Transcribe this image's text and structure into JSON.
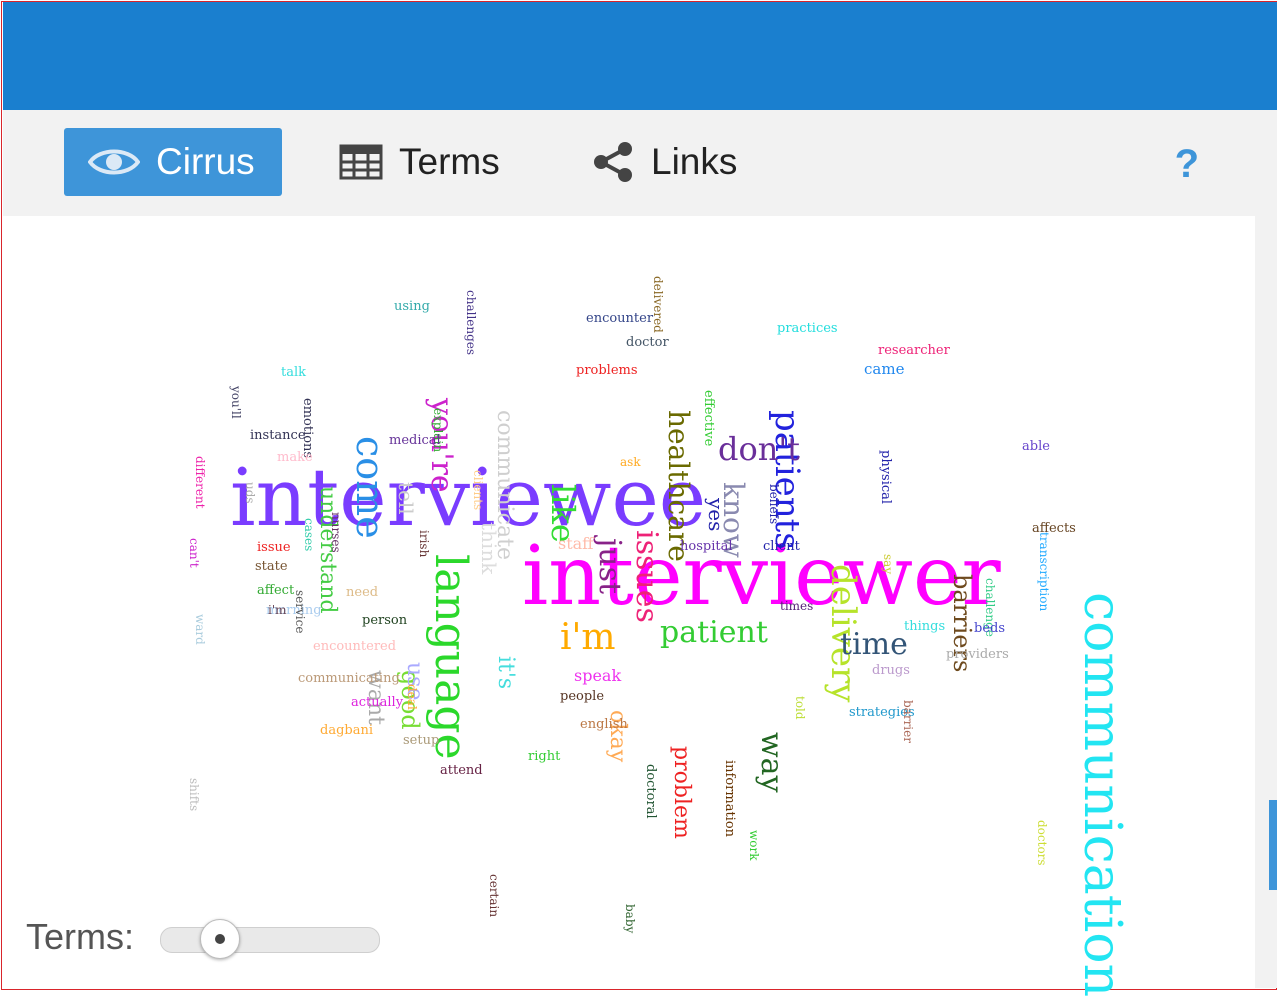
{
  "tabs": {
    "cirrus": "Cirrus",
    "terms": "Terms",
    "links": "Links",
    "help": "?"
  },
  "colors": {
    "topbar": "#1a7fcf",
    "active_tab": "#3e95d9",
    "border": "#d9252b"
  },
  "slider": {
    "label": "Terms:",
    "value_fraction": 0.22
  },
  "cloud": {
    "words": [
      {
        "text": "interviewee",
        "color": "#7a3cff"
      },
      {
        "text": "interviewer",
        "color": "#ff00ff"
      },
      {
        "text": "communication",
        "color": "#22e5f2"
      },
      {
        "text": "language",
        "color": "#2bd82b"
      },
      {
        "text": "patients",
        "color": "#2222dd"
      },
      {
        "text": "delivery",
        "color": "#b6e32a"
      },
      {
        "text": "come",
        "color": "#2a8fe6"
      },
      {
        "text": "you're",
        "color": "#cc22cc"
      },
      {
        "text": "healthcare",
        "color": "#6a6a00"
      },
      {
        "text": "like",
        "color": "#33dd33"
      },
      {
        "text": "just",
        "color": "#882288"
      },
      {
        "text": "issues",
        "color": "#ee2277"
      },
      {
        "text": "know",
        "color": "#8a8ab0"
      },
      {
        "text": "don't",
        "color": "#6a2f9a"
      },
      {
        "text": "communicate",
        "color": "#cfcfcf"
      },
      {
        "text": "barriers",
        "color": "#6e4a1e"
      },
      {
        "text": "time",
        "color": "#335577"
      },
      {
        "text": "i'm",
        "color": "#ffaa00"
      },
      {
        "text": "patient",
        "color": "#33cc33"
      },
      {
        "text": "way",
        "color": "#226622"
      },
      {
        "text": "understand",
        "color": "#44cc44"
      },
      {
        "text": "good",
        "color": "#77dd33"
      },
      {
        "text": "want",
        "color": "#aaaaaa"
      },
      {
        "text": "it's",
        "color": "#44dddd"
      },
      {
        "text": "okay",
        "color": "#ffaa55"
      },
      {
        "text": "problem",
        "color": "#ee2222"
      },
      {
        "text": "use",
        "color": "#aaaaff"
      },
      {
        "text": "tell",
        "color": "#cccccc"
      },
      {
        "text": "think",
        "color": "#dddddd"
      },
      {
        "text": "yes",
        "color": "#2222aa"
      },
      {
        "text": "staff",
        "color": "#ffbbaa"
      },
      {
        "text": "speak",
        "color": "#ee33ee"
      },
      {
        "text": "doctoral",
        "color": "#225533"
      },
      {
        "text": "information",
        "color": "#663300"
      },
      {
        "text": "emotions",
        "color": "#333355"
      },
      {
        "text": "challenges",
        "color": "#443388"
      },
      {
        "text": "delivered",
        "color": "#886622"
      },
      {
        "text": "effective",
        "color": "#33cc33"
      },
      {
        "text": "practices",
        "color": "#22dddd"
      },
      {
        "text": "researcher",
        "color": "#ee2277"
      },
      {
        "text": "came",
        "color": "#2288ee"
      },
      {
        "text": "physical",
        "color": "#2222aa"
      },
      {
        "text": "beliefs",
        "color": "#2222aa"
      },
      {
        "text": "transcription",
        "color": "#22aaff"
      },
      {
        "text": "able",
        "color": "#6644cc"
      },
      {
        "text": "challenge",
        "color": "#33cc88"
      },
      {
        "text": "affects",
        "color": "#664422"
      },
      {
        "text": "say",
        "color": "#cccc33"
      },
      {
        "text": "using",
        "color": "#33aaaa"
      },
      {
        "text": "explain",
        "color": "#33aa33"
      },
      {
        "text": "clients",
        "color": "#ffcc88"
      },
      {
        "text": "encounter",
        "color": "#334488"
      },
      {
        "text": "doctor",
        "color": "#445566"
      },
      {
        "text": "problems",
        "color": "#ee2222"
      },
      {
        "text": "medical",
        "color": "#663399"
      },
      {
        "text": "you'll",
        "color": "#444466"
      },
      {
        "text": "talk",
        "color": "#33dddd"
      },
      {
        "text": "cases",
        "color": "#33ccaa"
      },
      {
        "text": "nurses",
        "color": "#663366"
      },
      {
        "text": "instance",
        "color": "#333355"
      },
      {
        "text": "different",
        "color": "#ee22aa"
      },
      {
        "text": "make",
        "color": "#ffbbcc"
      },
      {
        "text": "uds",
        "color": "#aaaaaa"
      },
      {
        "text": "irish",
        "color": "#663333"
      },
      {
        "text": "ask",
        "color": "#ffaa22"
      },
      {
        "text": "can't",
        "color": "#cc22cc"
      },
      {
        "text": "issue",
        "color": "#ee2222"
      },
      {
        "text": "state",
        "color": "#775533"
      },
      {
        "text": "affect",
        "color": "#33aa33"
      },
      {
        "text": "morning",
        "color": "#aaccee"
      },
      {
        "text": "need",
        "color": "#ddbb88"
      },
      {
        "text": "service",
        "color": "#555555"
      },
      {
        "text": "things",
        "color": "#33dddd"
      },
      {
        "text": "person",
        "color": "#224422"
      },
      {
        "text": "encountered",
        "color": "#ffbbbb"
      },
      {
        "text": "deal",
        "color": "#ffaa33"
      },
      {
        "text": "communicating",
        "color": "#bb9977"
      },
      {
        "text": "actually",
        "color": "#dd22dd"
      },
      {
        "text": "dagbani",
        "color": "#ffaa33"
      },
      {
        "text": "setup",
        "color": "#aa9977"
      },
      {
        "text": "attend",
        "color": "#662244"
      },
      {
        "text": "right",
        "color": "#33cc33"
      },
      {
        "text": "people",
        "color": "#553322"
      },
      {
        "text": "english",
        "color": "#bb7744"
      },
      {
        "text": "certain",
        "color": "#663333"
      },
      {
        "text": "baby",
        "color": "#336633"
      },
      {
        "text": "work",
        "color": "#33cc33"
      },
      {
        "text": "hospital",
        "color": "#6633aa"
      },
      {
        "text": "client",
        "color": "#2222aa"
      },
      {
        "text": "drugs",
        "color": "#bb99cc"
      },
      {
        "text": "strategies",
        "color": "#2299cc"
      },
      {
        "text": "beds",
        "color": "#4444cc"
      },
      {
        "text": "providers",
        "color": "#aaaaaa"
      },
      {
        "text": "doctors",
        "color": "#ccdd33"
      },
      {
        "text": "barrier",
        "color": "#aa6655"
      },
      {
        "text": "told",
        "color": "#bbdd33"
      },
      {
        "text": "ward",
        "color": "#aaccdd"
      },
      {
        "text": "shifts",
        "color": "#bbbbbb"
      },
      {
        "text": "i'm",
        "color": "#664455"
      },
      {
        "text": "times",
        "color": "#552277"
      }
    ]
  }
}
